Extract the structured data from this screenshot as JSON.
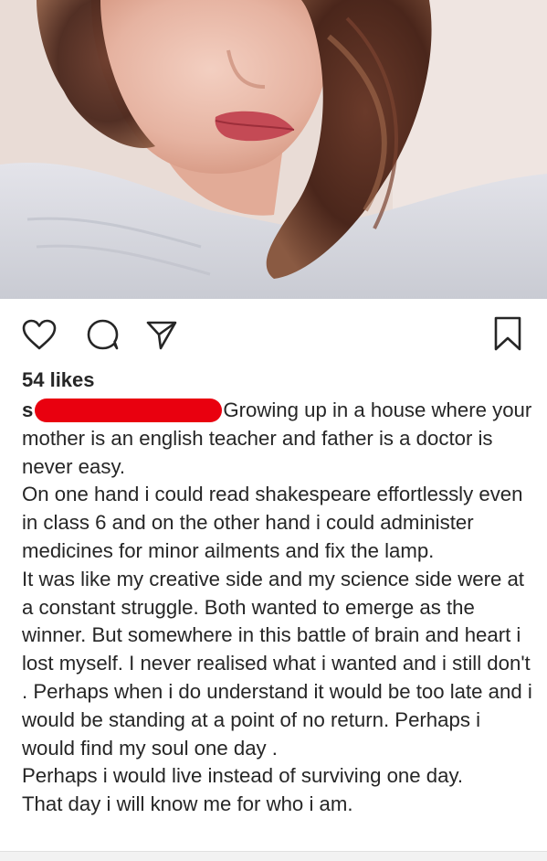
{
  "post": {
    "image_alt": "Close-up selfie photo",
    "likes_text": "54 likes",
    "username_visible": "s",
    "caption_first_line": "Growing up in a house where your mother is an english teacher and father is a doctor is never easy.",
    "caption_paragraphs": [
      "On one hand i could read shakespeare effortlessly even in class 6 and on the other hand i could administer medicines for minor ailments and  fix the lamp.",
      "It was like my creative side and my science side were at a constant struggle. Both wanted to emerge as the winner. But somewhere in this battle of brain and heart i lost myself. I never realised what i wanted and i still don't . Perhaps when i do understand it would be too late and i would be standing at a point of no return. Perhaps i would find my soul one day .",
      "Perhaps i would live instead of surviving one day.",
      "That day i will know me for who i am."
    ]
  },
  "actions": {
    "like_icon": "heart-icon",
    "comment_icon": "comment-icon",
    "share_icon": "send-icon",
    "save_icon": "bookmark-icon"
  },
  "colors": {
    "text": "#262626",
    "redaction": "#e9000f"
  }
}
